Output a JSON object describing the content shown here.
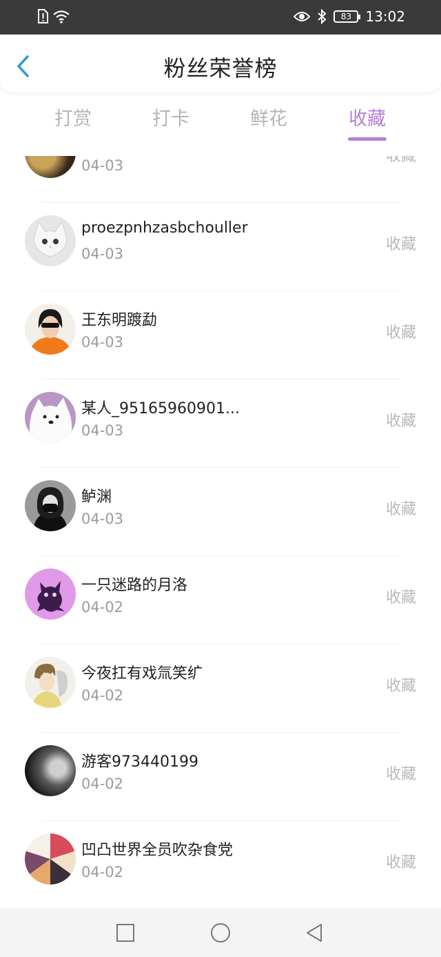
{
  "status_bar": {
    "time": "13:02",
    "battery": "83",
    "left_icons": [
      "sim-alert-icon",
      "wifi-icon"
    ],
    "right_icons": [
      "eye-icon",
      "bluetooth-icon",
      "battery-icon"
    ]
  },
  "header": {
    "title": "粉丝荣誉榜",
    "back_icon": "chevron-left-icon"
  },
  "tabs": [
    {
      "label": "打赏",
      "active": false
    },
    {
      "label": "打卡",
      "active": false
    },
    {
      "label": "鲜花",
      "active": false
    },
    {
      "label": "收藏",
      "active": true
    }
  ],
  "list": {
    "items": [
      {
        "name": "",
        "date": "04-03",
        "action": "收藏"
      },
      {
        "name": "proezpnhzasbchouller",
        "date": "04-03",
        "action": "收藏"
      },
      {
        "name": "王东明踱勐",
        "date": "04-03",
        "action": "收藏"
      },
      {
        "name": "某人_95165960901...",
        "date": "04-03",
        "action": "收藏"
      },
      {
        "name": "鲈渊",
        "date": "04-03",
        "action": "收藏"
      },
      {
        "name": "一只迷路的月洛",
        "date": "04-02",
        "action": "收藏"
      },
      {
        "name": "今夜扛有戏氚笑纩",
        "date": "04-02",
        "action": "收藏"
      },
      {
        "name": "游客973440199",
        "date": "04-02",
        "action": "收藏"
      },
      {
        "name": "凹凸世界全员吹杂食党",
        "date": "04-02",
        "action": "收藏"
      }
    ]
  },
  "nav_bar": {
    "icons": [
      "square-recents-icon",
      "circle-home-icon",
      "triangle-back-icon"
    ]
  },
  "colors": {
    "accent": "#b57fd9",
    "back_arrow": "#2e9bd6",
    "status_bar": "#3a3a3a"
  }
}
